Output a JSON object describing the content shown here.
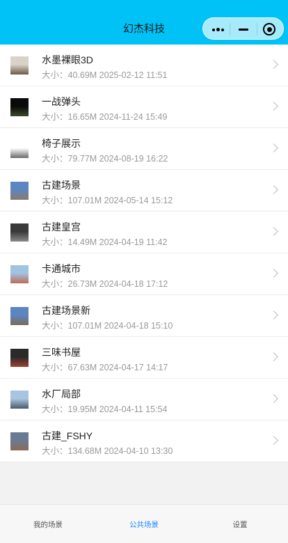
{
  "header": {
    "title": "幻杰科技",
    "background": "#00c2f6"
  },
  "capsule": {
    "more_icon": "more-dots-icon",
    "minimize_icon": "minimize-icon",
    "close_icon": "target-close-icon"
  },
  "items": [
    {
      "title": "水墨裸眼3D",
      "meta": "大小：40.69M 2025-02-12 11:51",
      "thumb_colors": [
        "#d9d2c8",
        "#6b5a4a"
      ]
    },
    {
      "title": "一战弹头",
      "meta": "大小：16.65M 2024-11-24 15:49",
      "thumb_colors": [
        "#0a0a0a",
        "#3a4a2a"
      ]
    },
    {
      "title": "椅子展示",
      "meta": "大小：79.77M 2024-08-19 16:22",
      "thumb_colors": [
        "#ffffff",
        "#6a6a6a"
      ]
    },
    {
      "title": "古建场景",
      "meta": "大小：107.01M 2024-05-14 15:12",
      "thumb_colors": [
        "#5b86c0",
        "#8a7a6a"
      ]
    },
    {
      "title": "古建皇宫",
      "meta": "大小：14.49M 2024-04-19 11:42",
      "thumb_colors": [
        "#3a3a3a",
        "#8a8a8a"
      ]
    },
    {
      "title": "卡通城市",
      "meta": "大小：26.73M 2024-04-18 17:12",
      "thumb_colors": [
        "#9fc3e0",
        "#c06a5a"
      ]
    },
    {
      "title": "古建场景新",
      "meta": "大小：107.01M 2024-04-18 15:10",
      "thumb_colors": [
        "#5b86c0",
        "#7a6a5a"
      ]
    },
    {
      "title": "三味书屋",
      "meta": "大小：67.63M 2024-04-17 14:17",
      "thumb_colors": [
        "#2a2a2a",
        "#a04030"
      ]
    },
    {
      "title": "水厂局部",
      "meta": "大小：19.95M 2024-04-11 15:54",
      "thumb_colors": [
        "#a8c4e0",
        "#4a5a6a"
      ]
    },
    {
      "title": "古建_FSHY",
      "meta": "大小：134.68M 2024-04-10 13:30",
      "thumb_colors": [
        "#6a7a90",
        "#8a6a5a"
      ]
    }
  ],
  "tabbar": {
    "tabs": [
      {
        "label": "我的场景",
        "active": false
      },
      {
        "label": "公共场景",
        "active": true
      },
      {
        "label": "设置",
        "active": false
      }
    ],
    "active_color": "#1a88ff"
  }
}
